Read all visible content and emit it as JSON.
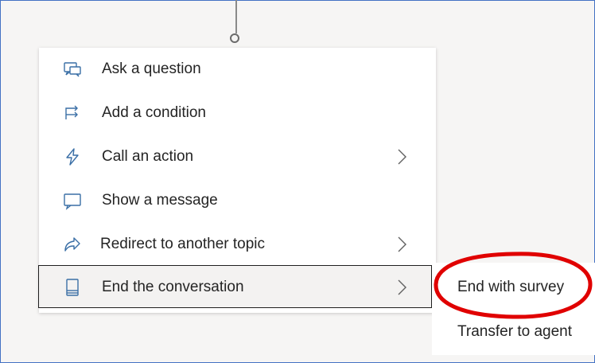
{
  "menu": {
    "items": [
      {
        "label": "Ask a question",
        "icon": "ask-question-icon",
        "has_submenu": false
      },
      {
        "label": "Add a condition",
        "icon": "condition-branch-icon",
        "has_submenu": false
      },
      {
        "label": "Call an action",
        "icon": "lightning-icon",
        "has_submenu": true
      },
      {
        "label": "Show a message",
        "icon": "message-icon",
        "has_submenu": false
      },
      {
        "label": "Redirect to another topic",
        "icon": "redirect-arrow-icon",
        "has_submenu": true
      },
      {
        "label": "End the conversation",
        "icon": "end-conversation-icon",
        "has_submenu": true,
        "selected": true
      }
    ]
  },
  "submenu": {
    "items": [
      {
        "label": "End with survey"
      },
      {
        "label": "Transfer to agent"
      }
    ]
  },
  "colors": {
    "icon_blue": "#3a6fa6",
    "annotation_red": "#e00000",
    "frame_border": "#4472c4"
  }
}
